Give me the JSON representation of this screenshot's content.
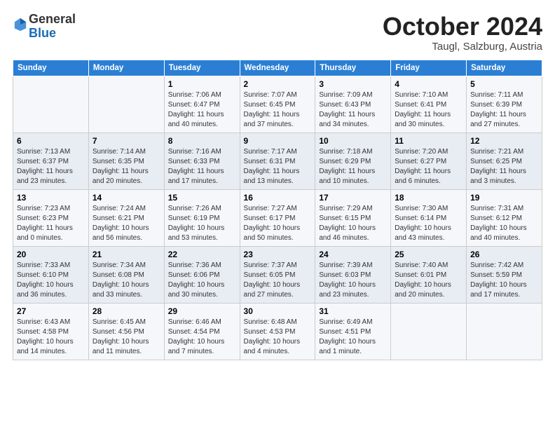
{
  "header": {
    "logo": {
      "line1": "General",
      "line2": "Blue"
    },
    "title": "October 2024",
    "location": "Taugl, Salzburg, Austria"
  },
  "weekdays": [
    "Sunday",
    "Monday",
    "Tuesday",
    "Wednesday",
    "Thursday",
    "Friday",
    "Saturday"
  ],
  "weeks": [
    [
      {
        "day": "",
        "info": ""
      },
      {
        "day": "",
        "info": ""
      },
      {
        "day": "1",
        "info": "Sunrise: 7:06 AM\nSunset: 6:47 PM\nDaylight: 11 hours and 40 minutes."
      },
      {
        "day": "2",
        "info": "Sunrise: 7:07 AM\nSunset: 6:45 PM\nDaylight: 11 hours and 37 minutes."
      },
      {
        "day": "3",
        "info": "Sunrise: 7:09 AM\nSunset: 6:43 PM\nDaylight: 11 hours and 34 minutes."
      },
      {
        "day": "4",
        "info": "Sunrise: 7:10 AM\nSunset: 6:41 PM\nDaylight: 11 hours and 30 minutes."
      },
      {
        "day": "5",
        "info": "Sunrise: 7:11 AM\nSunset: 6:39 PM\nDaylight: 11 hours and 27 minutes."
      }
    ],
    [
      {
        "day": "6",
        "info": "Sunrise: 7:13 AM\nSunset: 6:37 PM\nDaylight: 11 hours and 23 minutes."
      },
      {
        "day": "7",
        "info": "Sunrise: 7:14 AM\nSunset: 6:35 PM\nDaylight: 11 hours and 20 minutes."
      },
      {
        "day": "8",
        "info": "Sunrise: 7:16 AM\nSunset: 6:33 PM\nDaylight: 11 hours and 17 minutes."
      },
      {
        "day": "9",
        "info": "Sunrise: 7:17 AM\nSunset: 6:31 PM\nDaylight: 11 hours and 13 minutes."
      },
      {
        "day": "10",
        "info": "Sunrise: 7:18 AM\nSunset: 6:29 PM\nDaylight: 11 hours and 10 minutes."
      },
      {
        "day": "11",
        "info": "Sunrise: 7:20 AM\nSunset: 6:27 PM\nDaylight: 11 hours and 6 minutes."
      },
      {
        "day": "12",
        "info": "Sunrise: 7:21 AM\nSunset: 6:25 PM\nDaylight: 11 hours and 3 minutes."
      }
    ],
    [
      {
        "day": "13",
        "info": "Sunrise: 7:23 AM\nSunset: 6:23 PM\nDaylight: 11 hours and 0 minutes."
      },
      {
        "day": "14",
        "info": "Sunrise: 7:24 AM\nSunset: 6:21 PM\nDaylight: 10 hours and 56 minutes."
      },
      {
        "day": "15",
        "info": "Sunrise: 7:26 AM\nSunset: 6:19 PM\nDaylight: 10 hours and 53 minutes."
      },
      {
        "day": "16",
        "info": "Sunrise: 7:27 AM\nSunset: 6:17 PM\nDaylight: 10 hours and 50 minutes."
      },
      {
        "day": "17",
        "info": "Sunrise: 7:29 AM\nSunset: 6:15 PM\nDaylight: 10 hours and 46 minutes."
      },
      {
        "day": "18",
        "info": "Sunrise: 7:30 AM\nSunset: 6:14 PM\nDaylight: 10 hours and 43 minutes."
      },
      {
        "day": "19",
        "info": "Sunrise: 7:31 AM\nSunset: 6:12 PM\nDaylight: 10 hours and 40 minutes."
      }
    ],
    [
      {
        "day": "20",
        "info": "Sunrise: 7:33 AM\nSunset: 6:10 PM\nDaylight: 10 hours and 36 minutes."
      },
      {
        "day": "21",
        "info": "Sunrise: 7:34 AM\nSunset: 6:08 PM\nDaylight: 10 hours and 33 minutes."
      },
      {
        "day": "22",
        "info": "Sunrise: 7:36 AM\nSunset: 6:06 PM\nDaylight: 10 hours and 30 minutes."
      },
      {
        "day": "23",
        "info": "Sunrise: 7:37 AM\nSunset: 6:05 PM\nDaylight: 10 hours and 27 minutes."
      },
      {
        "day": "24",
        "info": "Sunrise: 7:39 AM\nSunset: 6:03 PM\nDaylight: 10 hours and 23 minutes."
      },
      {
        "day": "25",
        "info": "Sunrise: 7:40 AM\nSunset: 6:01 PM\nDaylight: 10 hours and 20 minutes."
      },
      {
        "day": "26",
        "info": "Sunrise: 7:42 AM\nSunset: 5:59 PM\nDaylight: 10 hours and 17 minutes."
      }
    ],
    [
      {
        "day": "27",
        "info": "Sunrise: 6:43 AM\nSunset: 4:58 PM\nDaylight: 10 hours and 14 minutes."
      },
      {
        "day": "28",
        "info": "Sunrise: 6:45 AM\nSunset: 4:56 PM\nDaylight: 10 hours and 11 minutes."
      },
      {
        "day": "29",
        "info": "Sunrise: 6:46 AM\nSunset: 4:54 PM\nDaylight: 10 hours and 7 minutes."
      },
      {
        "day": "30",
        "info": "Sunrise: 6:48 AM\nSunset: 4:53 PM\nDaylight: 10 hours and 4 minutes."
      },
      {
        "day": "31",
        "info": "Sunrise: 6:49 AM\nSunset: 4:51 PM\nDaylight: 10 hours and 1 minute."
      },
      {
        "day": "",
        "info": ""
      },
      {
        "day": "",
        "info": ""
      }
    ]
  ]
}
